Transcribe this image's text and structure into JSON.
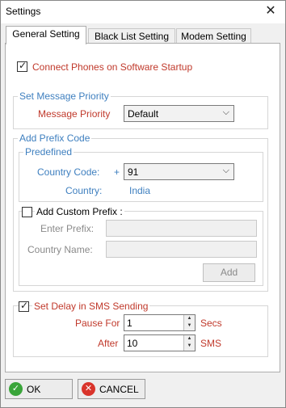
{
  "window": {
    "title": "Settings",
    "close_glyph": "✕"
  },
  "tabs": [
    {
      "label": "General Setting"
    },
    {
      "label": "Black List Setting"
    },
    {
      "label": "Modem Setting"
    }
  ],
  "general": {
    "connect_phones": {
      "label": "Connect Phones on Software Startup",
      "checked": true
    },
    "message_priority_group": {
      "title": "Set Message Priority",
      "label": "Message Priority",
      "value": "Default"
    },
    "prefix_group": {
      "title": "Add Prefix Code",
      "predefined": {
        "title": "Predefined",
        "country_code_label": "Country Code:",
        "plus": "+",
        "country_code_value": "91",
        "country_label": "Country:",
        "country_value": "India"
      },
      "custom": {
        "label": "Add Custom Prefix :",
        "checked": false,
        "enter_prefix_label": "Enter Prefix:",
        "enter_prefix_value": "",
        "country_name_label": "Country Name:",
        "country_name_value": "",
        "add_label": "Add"
      }
    },
    "delay_group": {
      "label": "Set Delay in SMS Sending",
      "checked": true,
      "pause_for_label": "Pause For",
      "pause_for_value": "1",
      "pause_unit": "Secs",
      "after_label": "After",
      "after_value": "10",
      "after_unit": "SMS"
    }
  },
  "footer": {
    "ok_label": "OK",
    "cancel_label": "CANCEL"
  },
  "colors": {
    "accent_red": "#c0392b",
    "accent_blue": "#3e7fbf",
    "ok_icon": "#3aa53a",
    "cancel_icon": "#d9342b"
  }
}
